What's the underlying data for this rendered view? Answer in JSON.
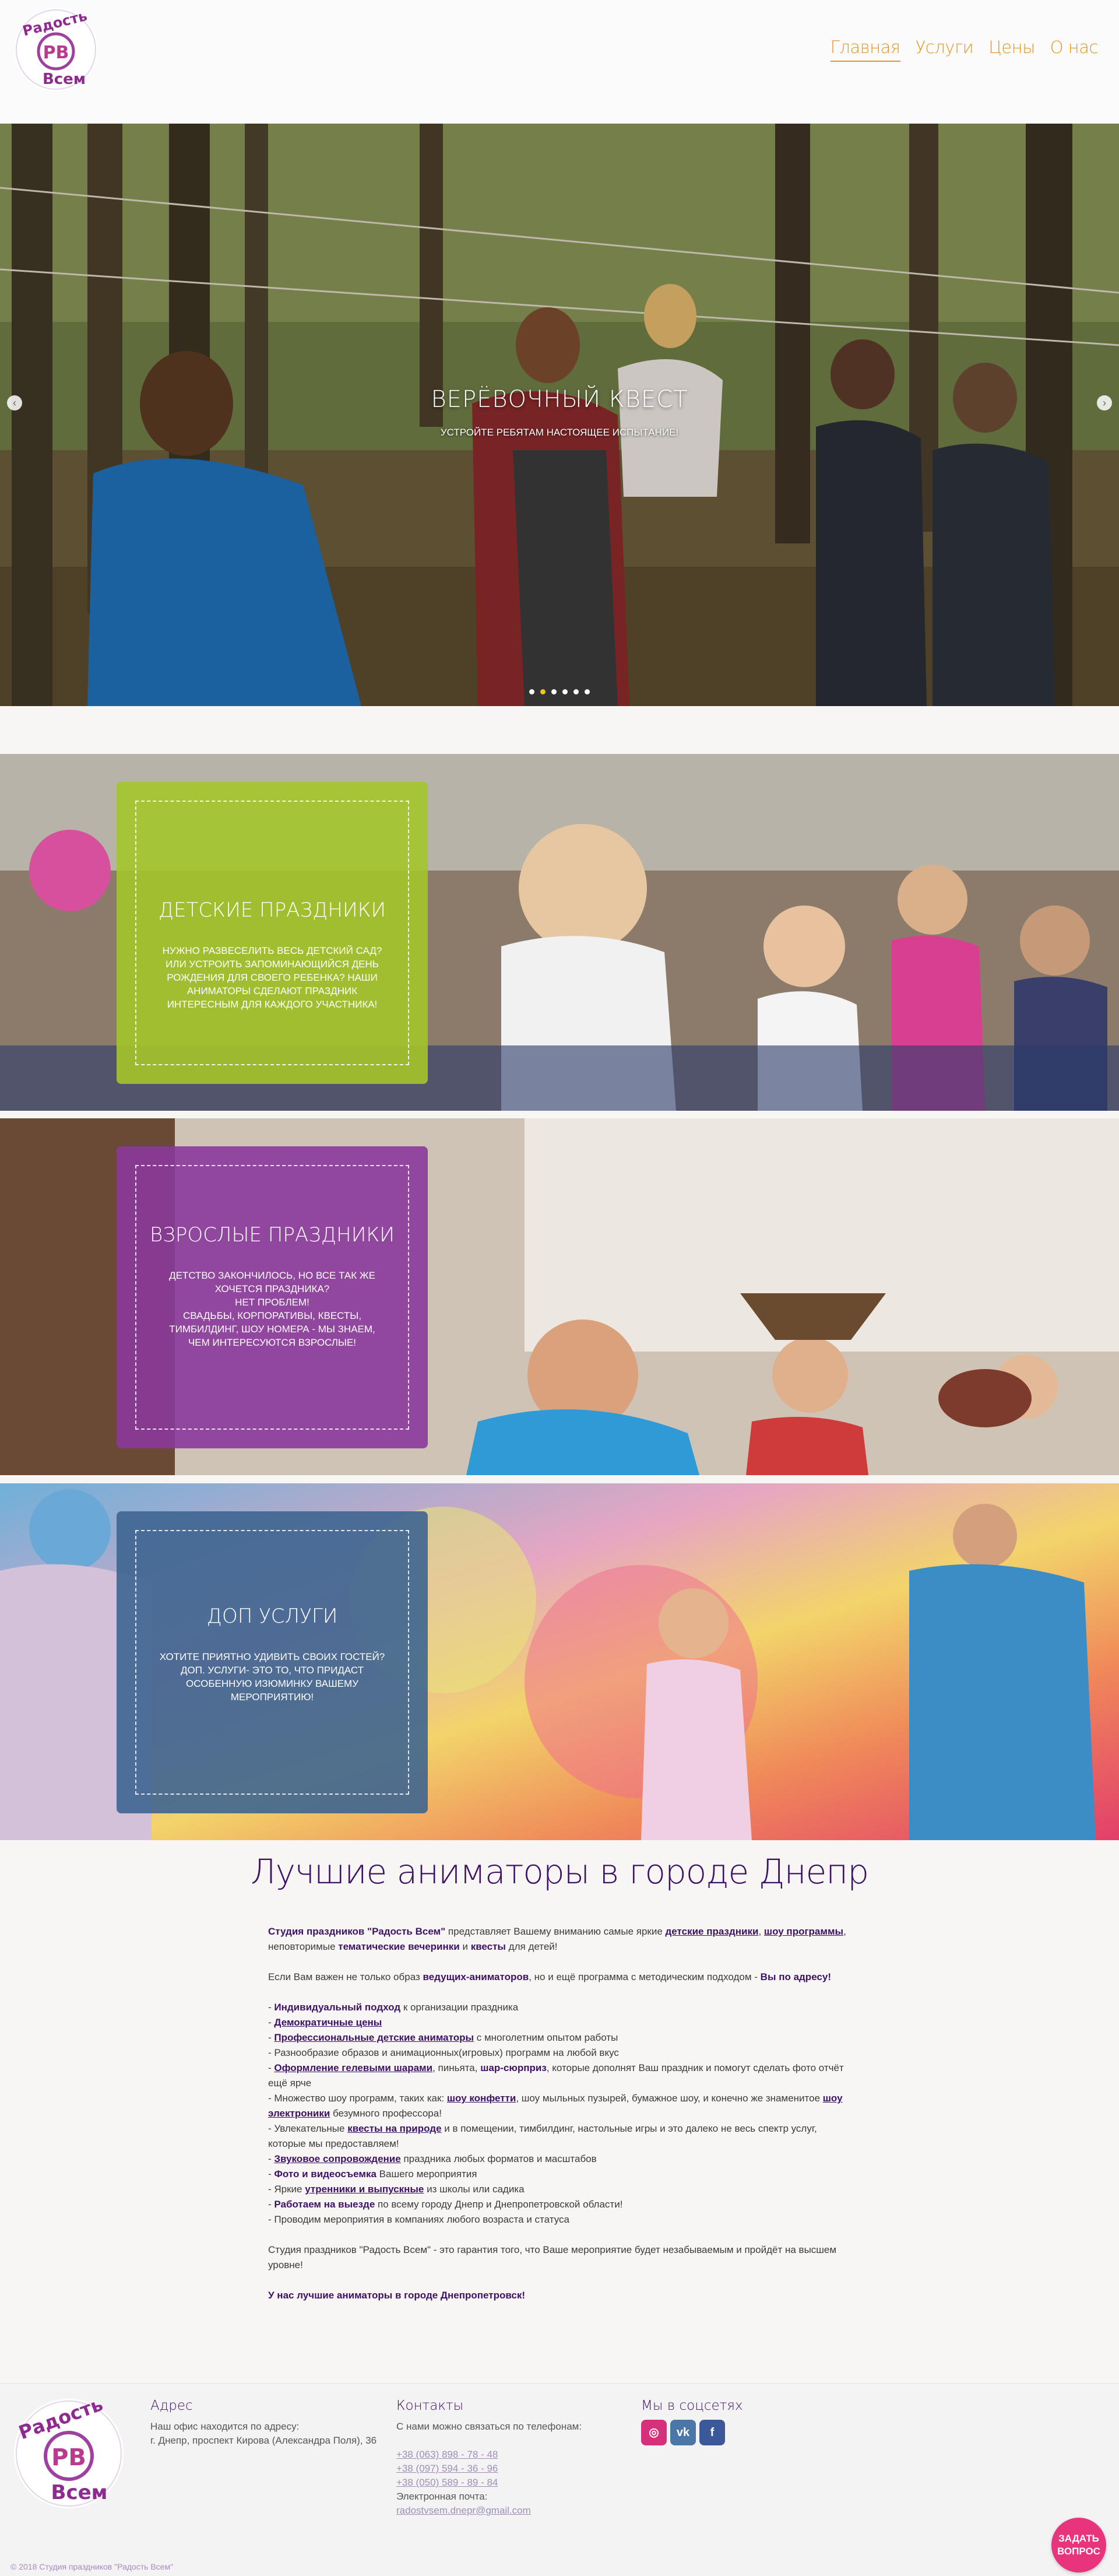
{
  "brand": {
    "logo_text_top": "Радость",
    "logo_monogram": "РВ",
    "logo_text_bottom": "Всем"
  },
  "nav": [
    {
      "label": "Главная",
      "active": true
    },
    {
      "label": "Услуги",
      "active": false
    },
    {
      "label": "Цены",
      "active": false
    },
    {
      "label": "О нас",
      "active": false
    }
  ],
  "hero": {
    "title": "ВЕРЁВОЧНЫЙ КВЕСТ",
    "subtitle": "УСТРОЙТЕ РЕБЯТАМ НАСТОЯЩЕЕ ИСПЫТАНИЕ!",
    "slide_count": 6,
    "active_slide": 2
  },
  "services": [
    {
      "title": "ДЕТСКИЕ ПРАЗДНИКИ",
      "text": [
        "НУЖНО РАЗВЕСЕЛИТЬ ВЕСЬ ДЕТСКИЙ САД? ИЛИ УСТРОИТЬ ЗАПОМИНАЮЩИЙСЯ ДЕНЬ РОЖДЕНИЯ ДЛЯ СВОЕГО РЕБЕНКА? НАШИ АНИМАТОРЫ СДЕЛАЮТ ПРАЗДНИК ИНТЕРЕСНЫМ ДЛЯ КАЖДОГО УЧАСТНИКА!"
      ],
      "color": "#a3c52a"
    },
    {
      "title": "ВЗРОСЛЫЕ ПРАЗДНИКИ",
      "text": [
        "ДЕТСТВО ЗАКОНЧИЛОСЬ, НО ВСЕ ТАК ЖЕ ХОЧЕТСЯ ПРАЗДНИКА?",
        "НЕТ ПРОБЛЕМ!",
        "СВАДЬБЫ, КОРПОРАТИВЫ, КВЕСТЫ, ТИМБИЛДИНГ, ШОУ НОМЕРА - МЫ ЗНАЕМ, ЧЕМ ИНТЕРЕСУЮТСЯ ВЗРОСЛЫЕ!"
      ],
      "color": "#8a3a9a"
    },
    {
      "title": "ДОП УСЛУГИ",
      "text": [
        "ХОТИТЕ ПРИЯТНО УДИВИТЬ СВОИХ ГОСТЕЙ? ДОП. УСЛУГИ- ЭТО ТО, ЧТО ПРИДАСТ ОСОБЕННУЮ ИЗЮМИНКУ ВАШЕМУ МЕРОПРИЯТИЮ!"
      ],
      "color": "#3e6590"
    }
  ],
  "main": {
    "heading": "Лучшие аниматоры в городе Днепр",
    "intro": {
      "b1": "Студия праздников \"Радость Всем\"",
      "t1": " представляет Вашему вниманию самые яркие ",
      "a1": "детские праздники",
      "t2": ", ",
      "a2": "шоу программы",
      "t3": ", неповторимые ",
      "b2": "тематические вечеринки",
      "t4": " и ",
      "b3": "квесты",
      "t5": " для детей!"
    },
    "p2": {
      "t1": "Если Вам важен не только образ ",
      "b1": "ведущих-аниматоров",
      "t2": ", но и ещё программа с методическим подходом - ",
      "b2": "Вы по адресу!"
    },
    "list": {
      "l1_b": "Индивидуальный подход",
      "l1_t": " к организации праздника",
      "l2_a": "Демократичные цены",
      "l3_a": "Профессиональные детские аниматоры",
      "l3_t": " с многолетним опытом работы",
      "l4_t": "Разнообразие образов и анимационных(игровых) программ на любой вкус",
      "l5_a": "Оформление гелевыми шарами",
      "l5_t1": ", пиньята, ",
      "l5_b": "шар-сюрприз",
      "l5_t2": ", которые дополнят Ваш праздник и помогут сделать фото отчёт ещё ярче",
      "l6_t1": "Множество шоу программ, таких как: ",
      "l6_a1": "шоу конфетти",
      "l6_t2": ", шоу мыльных пузырей, бумажное шоу, и конечно же знаменитое ",
      "l6_a2": "шоу электроники",
      "l6_t3": " безумного профессора!",
      "l7_t1": "Увлекательные ",
      "l7_a": "квесты на природе",
      "l7_t2": " и в помещении, тимбилдинг, настольные игры и это далеко не весь спектр услуг, которые мы предоставляем!",
      "l8_a": "Звуковое сопровождение",
      "l8_t": " праздника любых форматов и масштабов",
      "l9_b": "Фото и видеосъемка",
      "l9_t": " Вашего мероприятия",
      "l10_t1": "Яркие ",
      "l10_a": "утренники и выпускные",
      "l10_t2": " из школы или садика",
      "l11_b": "Работаем на выезде",
      "l11_t": " по всему городу Днепр и Днепропетровской области!",
      "l12_t": "Проводим мероприятия в компаниях любого возраста и статуса"
    },
    "p3": "Студия праздников \"Радость Всем\" - это гарантия того, что Ваше мероприятие будет незабываемым и пройдёт на высшем уровне!",
    "final": "У нас лучшие аниматоры в городе Днепропетровск!"
  },
  "footer": {
    "address_title": "Адрес",
    "address_lines": [
      "Наш офис находится по адресу:",
      "г. Днепр, проспект Кирова (Александра Поля), 36"
    ],
    "contacts_title": "Контакты",
    "contacts_intro": "С нами можно связаться по телефонам:",
    "phones": [
      "+38 (063) 898 - 78 - 48",
      "+38 (097) 594 - 36 - 96",
      "+38 (050) 589 - 89 - 84"
    ],
    "email_label": "Электронная почта:",
    "email": "radostvsem.dnepr@gmail.com",
    "social_title": "Мы в соцсетях",
    "social": [
      {
        "icon": "instagram-icon",
        "glyph": "◎",
        "color": "#d6307a"
      },
      {
        "icon": "vk-icon",
        "glyph": "vk",
        "color": "#4a76a8"
      },
      {
        "icon": "facebook-icon",
        "glyph": "f",
        "color": "#3b5998"
      }
    ],
    "copyright": "© 2018 Студия праздников \"Радость Всем\"",
    "ask_button": "ЗАДАТЬ ВОПРОС"
  },
  "colors": {
    "accent": "#e8951f",
    "brand_purple": "#3d1164",
    "ask_pink": "#e8337d"
  }
}
